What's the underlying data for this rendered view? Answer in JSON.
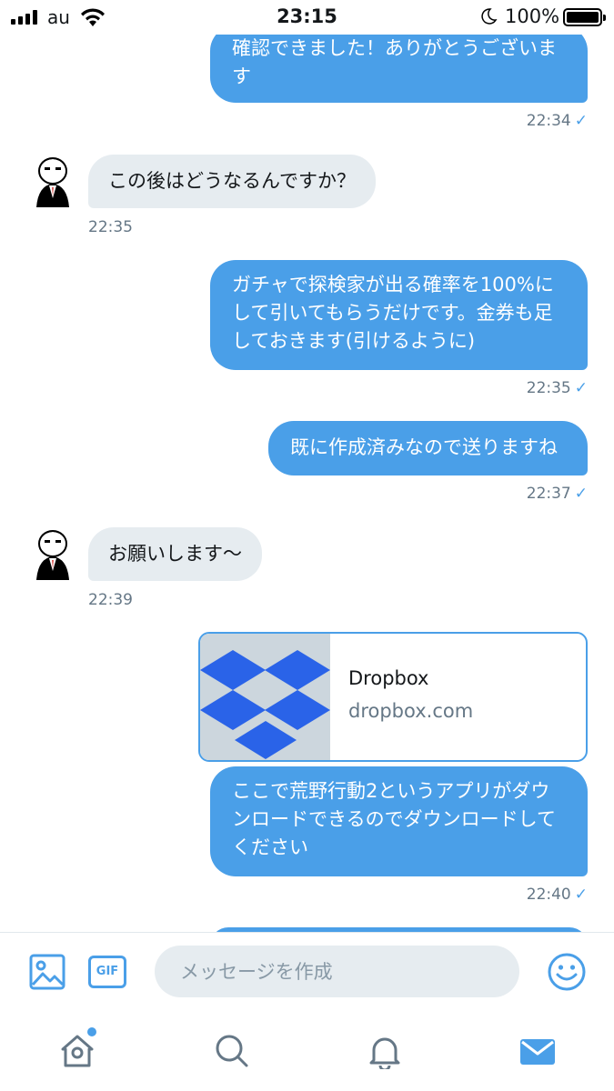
{
  "status_bar": {
    "carrier": "au",
    "time": "23:15",
    "battery": "100%"
  },
  "messages": [
    {
      "side": "out",
      "text_lines": [
        "確認できました！ありがとうございま",
        "す"
      ],
      "time": "22:34",
      "read": "✓"
    },
    {
      "side": "in",
      "text": "この後はどうなるんですか？",
      "time": "22:35"
    },
    {
      "side": "out",
      "text_lines": [
        "ガチャで探検家が出る確率を100%に",
        "して引いてもらうだけです。金券も足",
        "しておきます(引けるように)"
      ],
      "time": "22:35",
      "read": "✓"
    },
    {
      "side": "out",
      "text": "既に作成済みなので送りますね",
      "time": "22:37",
      "read": "✓"
    },
    {
      "side": "in",
      "text": "お願いします〜",
      "time": "22:39"
    },
    {
      "side": "out",
      "text_lines": [
        "ここで荒野行動2というアプリがダウ",
        "ンロードできるのでダウンロードして",
        "ください"
      ],
      "time": "22:40",
      "read": "✓"
    }
  ],
  "link_card": {
    "title": "Dropbox",
    "domain": "dropbox.com",
    "icon": "dropbox-logo"
  },
  "composer": {
    "placeholder": "メッセージを作成",
    "gif_label": "GIF",
    "image_icon": "image-icon",
    "emoji_icon": "emoji-icon"
  },
  "tabs": [
    {
      "name": "home",
      "icon": "home-icon",
      "has_notification_dot": true
    },
    {
      "name": "search",
      "icon": "search-icon"
    },
    {
      "name": "notifications",
      "icon": "bell-icon"
    },
    {
      "name": "messages",
      "icon": "mail-icon",
      "active": true
    }
  ],
  "colors": {
    "accent": "#4a9fe8",
    "incoming_bubble": "#e6ecf0",
    "timestamp": "#657786"
  }
}
